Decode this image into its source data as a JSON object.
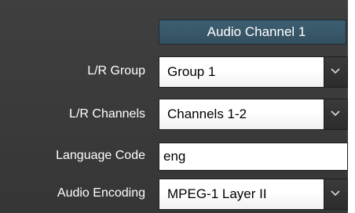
{
  "header": {
    "title": "Audio Channel 1"
  },
  "fields": {
    "lr_group": {
      "label": "L/R Group",
      "value": "Group 1"
    },
    "lr_channels": {
      "label": "L/R Channels",
      "value": "Channels 1-2"
    },
    "language_code": {
      "label": "Language Code",
      "value": "eng"
    },
    "audio_encoding": {
      "label": "Audio Encoding",
      "value": "MPEG-1 Layer II"
    }
  },
  "icons": {
    "dropdown": "chevron-down-icon"
  },
  "colors": {
    "panel_background": "#3b3b3b",
    "header_background": "#3a5a6c",
    "label_text": "#ffffff",
    "field_background": "#ffffff"
  }
}
